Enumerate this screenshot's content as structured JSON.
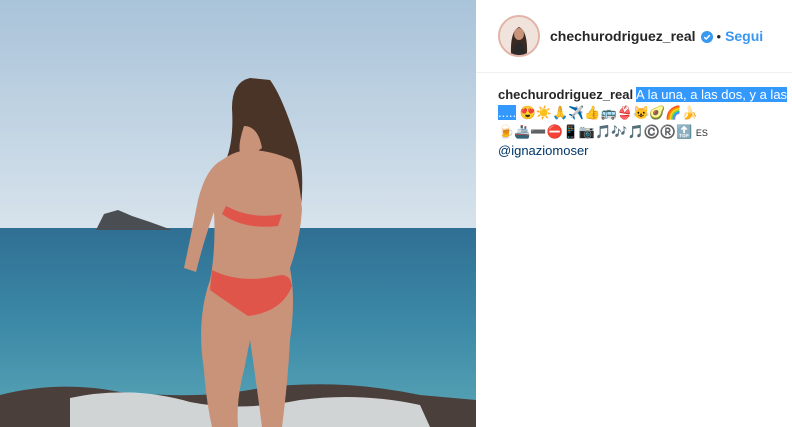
{
  "post": {
    "username": "chechurodriguez_real",
    "follow_separator": "•",
    "follow_label": "Segui",
    "caption_author": "chechurodriguez_real",
    "caption_text": "A la una, a las dos, y a las .....",
    "emoji_line_1": "😍☀️🙏✈️👍🚌👙😺🥑🌈🍌",
    "emoji_line_2": "🍺🚢➖⛔📱📷🎵🎶🎵©️®️🔝",
    "emoji_suffix": "ES",
    "mention": "@ignaziomoser"
  },
  "colors": {
    "accent_blue": "#3897f0",
    "selection_blue": "#3399ff",
    "mention_blue": "#003569"
  },
  "icons": [
    "verified-badge-icon"
  ]
}
